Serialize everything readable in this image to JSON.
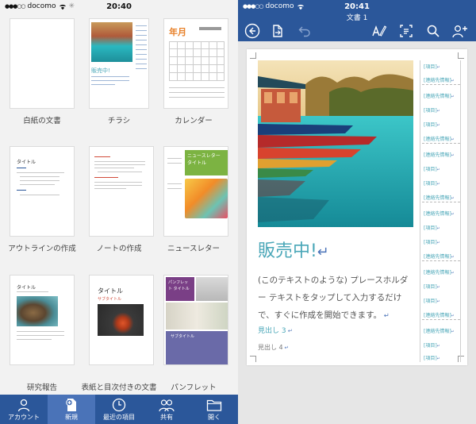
{
  "left_status": {
    "carrier": "docomo",
    "time": "20:40"
  },
  "templates": [
    {
      "label": "白紙の文書"
    },
    {
      "label": "チラシ",
      "headline": "販売中!"
    },
    {
      "label": "カレンダー",
      "month": "年月"
    },
    {
      "label": "アウトラインの作成",
      "title": "タイトル"
    },
    {
      "label": "ノートの作成"
    },
    {
      "label": "ニュースレター",
      "title": "ニュースレター タイトル"
    },
    {
      "label": "研究報告",
      "title": "タイトル"
    },
    {
      "label": "表紙と目次付きの文書",
      "title": "タイトル",
      "subtitle": "サブタイトル"
    },
    {
      "label": "パンフレット",
      "title": "パンフレット タイトル",
      "subtitle": "サブタイトル"
    }
  ],
  "tabs": [
    {
      "label": "アカウント",
      "icon": "account-icon"
    },
    {
      "label": "新規",
      "icon": "new-doc-icon",
      "active": true
    },
    {
      "label": "最近の項目",
      "icon": "clock-icon"
    },
    {
      "label": "共有",
      "icon": "shared-icon"
    },
    {
      "label": "開く",
      "icon": "folder-icon"
    }
  ],
  "right_status": {
    "carrier": "docomo",
    "time": "20:41"
  },
  "document": {
    "title": "文書 1",
    "headline": "販売中!",
    "body": "(このテキストのような) プレースホルダー テキストをタップして入力するだけで、すぐに作成を開始できます。",
    "heading3": "見出し 3",
    "heading4": "見出し 4",
    "sidebar_items": [
      "[項目]",
      "[連絡先情報]"
    ]
  },
  "colors": {
    "brand": "#2b579a",
    "accent": "#4aa7b8"
  }
}
